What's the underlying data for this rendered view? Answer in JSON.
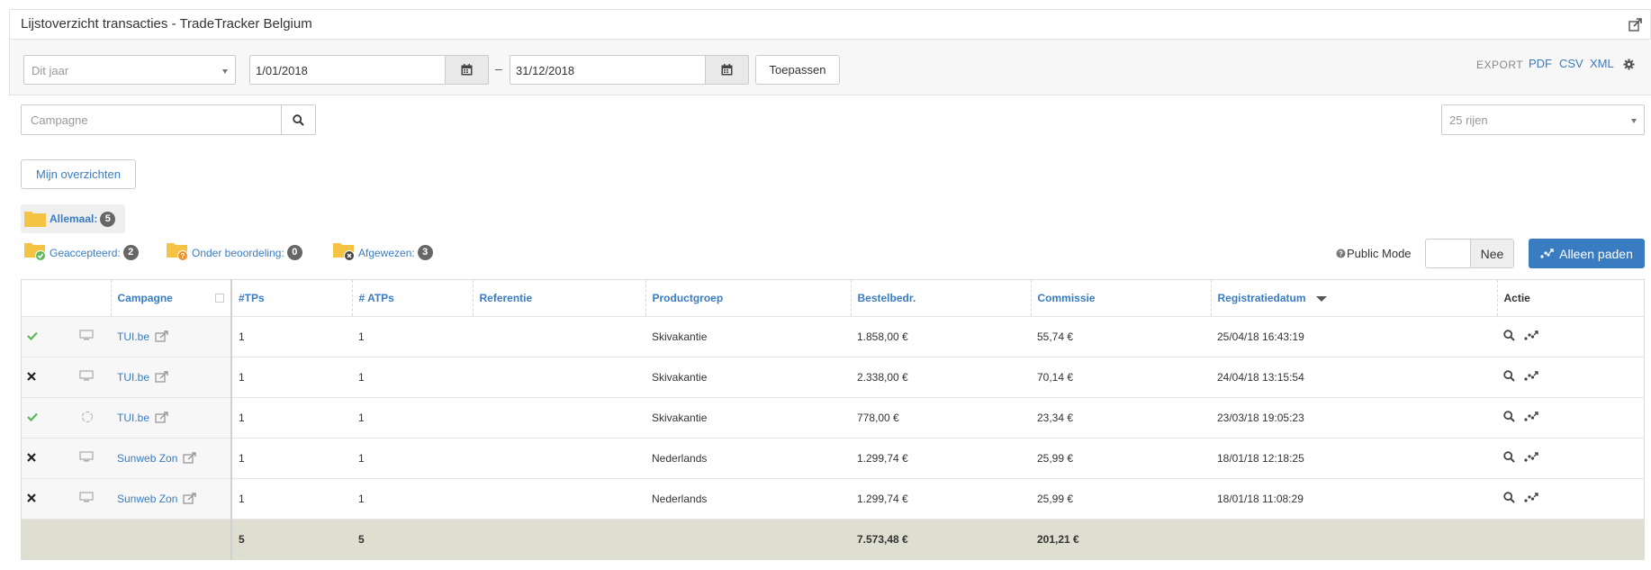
{
  "window": {
    "title": "Lijstoverzicht transacties - TradeTracker Belgium"
  },
  "filters": {
    "period_select": "Dit jaar",
    "date_from": "1/01/2018",
    "date_separator": "–",
    "date_to": "31/12/2018",
    "apply_label": "Toepassen",
    "export_label": "EXPORT",
    "export_formats": [
      "PDF",
      "CSV",
      "XML"
    ]
  },
  "search": {
    "placeholder": "Campagne",
    "rows_select": "25 rijen"
  },
  "overviews_button": "Mijn overzichten",
  "status_filters": {
    "all": {
      "label": "Allemaal:",
      "count": "5"
    },
    "accepted": {
      "label": "Geaccepteerd:",
      "count": "2"
    },
    "pending": {
      "label": "Onder beoordeling:",
      "count": "0"
    },
    "rejected": {
      "label": "Afgewezen:",
      "count": "3"
    }
  },
  "public_mode": {
    "label": "Public Mode",
    "value": "Nee"
  },
  "paths_button": "Alleen paden",
  "table": {
    "columns": [
      "Campagne",
      "#TPs",
      "# ATPs",
      "Referentie",
      "Productgroep",
      "Bestelbedr.",
      "Commissie",
      "Registratiedatum",
      "Actie"
    ],
    "rows": [
      {
        "status": "accepted",
        "device": "desktop",
        "campaign": "TUI.be",
        "tps": "1",
        "atps": "1",
        "reference": "",
        "product_group": "Skivakantie",
        "amount": "1.858,00 €",
        "commission": "55,74 €",
        "date": "25/04/18 16:43:19"
      },
      {
        "status": "rejected",
        "device": "desktop",
        "campaign": "TUI.be",
        "tps": "1",
        "atps": "1",
        "reference": "",
        "product_group": "Skivakantie",
        "amount": "2.338,00 €",
        "commission": "70,14 €",
        "date": "24/04/18 13:15:54"
      },
      {
        "status": "accepted",
        "device": "unknown",
        "campaign": "TUI.be",
        "tps": "1",
        "atps": "1",
        "reference": "",
        "product_group": "Skivakantie",
        "amount": "778,00 €",
        "commission": "23,34 €",
        "date": "23/03/18 19:05:23"
      },
      {
        "status": "rejected",
        "device": "desktop",
        "campaign": "Sunweb Zon",
        "tps": "1",
        "atps": "1",
        "reference": "",
        "product_group": "Nederlands",
        "amount": "1.299,74 €",
        "commission": "25,99 €",
        "date": "18/01/18 12:18:25"
      },
      {
        "status": "rejected",
        "device": "desktop",
        "campaign": "Sunweb Zon",
        "tps": "1",
        "atps": "1",
        "reference": "",
        "product_group": "Nederlands",
        "amount": "1.299,74 €",
        "commission": "25,99 €",
        "date": "18/01/18 11:08:29"
      }
    ],
    "totals": {
      "tps": "5",
      "atps": "5",
      "amount": "7.573,48 €",
      "commission": "201,21 €"
    }
  },
  "colors": {
    "accent": "#3a7cc1",
    "accepted": "#5cb85c",
    "folder": "#f5c343",
    "total_row": "#dedfd0"
  }
}
